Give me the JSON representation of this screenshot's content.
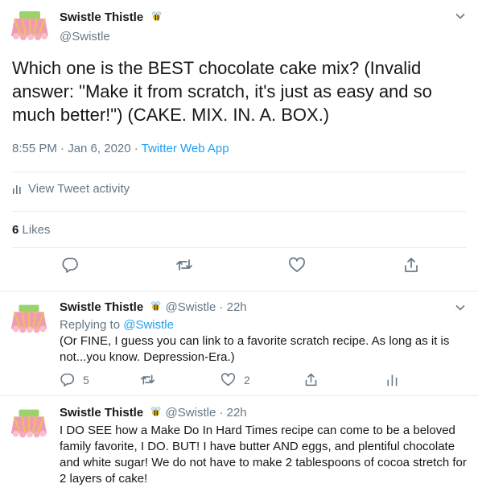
{
  "main_tweet": {
    "display_name": "Swistle Thistle",
    "handle": "@Swistle",
    "text": "Which one is the BEST chocolate cake mix? (Invalid answer: \"Make it from scratch, it's just as easy and so much better!\") (CAKE. MIX. IN. A. BOX.)",
    "timestamp": "8:55 PM · Jan 6, 2020 · ",
    "source": "Twitter Web App",
    "activity_label": "View Tweet activity",
    "likes_count": "6",
    "likes_label": " Likes"
  },
  "replies": [
    {
      "display_name": "Swistle Thistle",
      "handle": "@Swistle",
      "time": " · 22h",
      "replying_prefix": "Replying to ",
      "replying_to": "@Swistle",
      "text": "(Or FINE, I guess you can link to a favorite scratch recipe. As long as it is not...you know. Depression-Era.)",
      "reply_count": "5",
      "retweet_count": "",
      "like_count": "2"
    },
    {
      "display_name": "Swistle Thistle",
      "handle": "@Swistle",
      "time": " · 22h",
      "text": "I DO SEE how a Make Do In Hard Times recipe can come to be a beloved family favorite, I DO. BUT! I have butter AND eggs, and plentiful chocolate and white sugar! We do not have to make 2 tablespoons of cocoa stretch for 2 layers of cake!"
    }
  ],
  "colors": {
    "text": "#14171a",
    "secondary": "#657786",
    "link": "#1da1f2",
    "border": "#e6ecf0"
  },
  "icons": [
    "chevron-down-icon",
    "bee-emoji-icon",
    "bar-chart-icon",
    "reply-icon",
    "retweet-icon",
    "like-icon",
    "share-icon",
    "analytics-icon"
  ]
}
